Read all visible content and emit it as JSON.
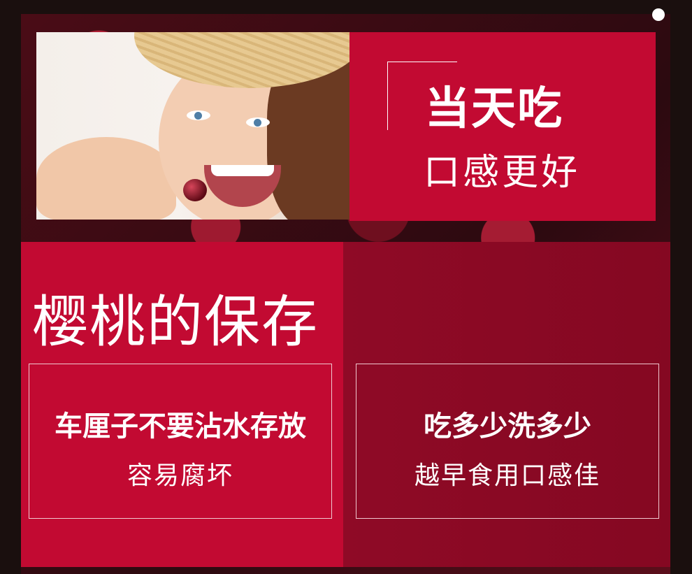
{
  "hero": {
    "title": "当天吃",
    "subtitle": "口感更好"
  },
  "storage": {
    "section_title": "樱桃的保存",
    "cards": [
      {
        "heading": "车厘子不要沾水存放",
        "text": "容易腐坏"
      },
      {
        "heading": "吃多少洗多少",
        "text": "越早食用口感佳"
      }
    ]
  },
  "colors": {
    "accent_red": "#c20a32",
    "dark_red": "#8f0a26",
    "text": "#ffffff"
  }
}
